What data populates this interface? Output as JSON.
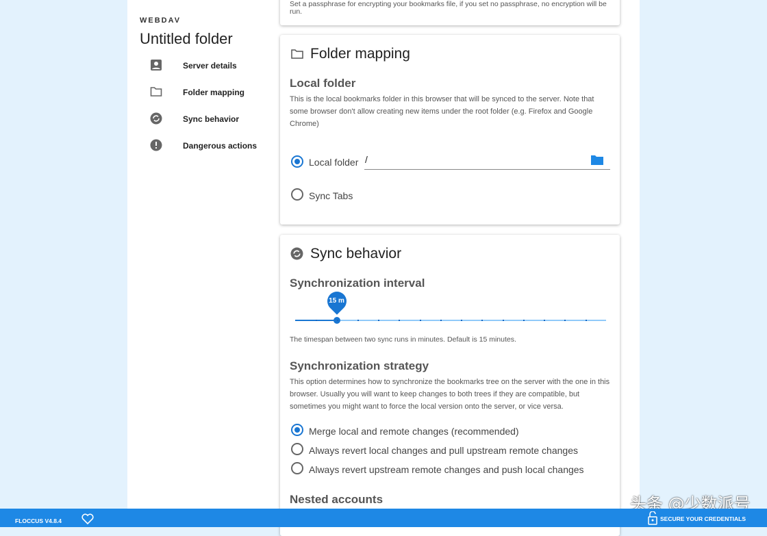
{
  "sidebar": {
    "brand": "WEBDAV",
    "title": "Untitled folder",
    "items": [
      {
        "label": "Server details",
        "icon": "account-box-icon"
      },
      {
        "label": "Folder mapping",
        "icon": "folder-icon"
      },
      {
        "label": "Sync behavior",
        "icon": "sync-icon"
      },
      {
        "label": "Dangerous actions",
        "icon": "alert-icon"
      }
    ]
  },
  "passphrase": {
    "hint": "Set a passphrase for encrypting your bookmarks file, if you set no passphrase, no encryption will be run."
  },
  "folder_mapping": {
    "title": "Folder mapping",
    "local_heading": "Local folder",
    "local_desc": "This is the local bookmarks folder in this browser that will be synced to the server. Note that some browser don't allow creating new items under the root folder (e.g. Firefox and Google Chrome)",
    "option_local": "Local folder",
    "local_value": "/",
    "option_tabs": "Sync Tabs",
    "selected": "local"
  },
  "sync": {
    "title": "Sync behavior",
    "interval_heading": "Synchronization interval",
    "interval_value_label": "15 m",
    "interval_value": 15,
    "interval_step_index": 2,
    "interval_steps": 16,
    "interval_desc": "The timespan between two sync runs in minutes. Default is 15 minutes.",
    "strategy_heading": "Synchronization strategy",
    "strategy_desc": "This option determines how to synchronize the bookmarks tree on the server with the one in this browser. Usually you will want to keep changes to both trees if they are compatible, but sometimes you might want to force the local version onto the server, or vice versa.",
    "strategies": [
      "Merge local and remote changes (recommended)",
      "Always revert local changes and pull upstream remote changes",
      "Always revert upstream remote changes and push local changes"
    ],
    "nested_heading": "Nested accounts"
  },
  "footer": {
    "version": "FLOCCUS V4.8.4",
    "secure": "SECURE YOUR CREDENTIALS"
  },
  "watermark": "头条 @少数派号",
  "colors": {
    "accent": "#1976d2",
    "footer": "#1e88e5"
  }
}
